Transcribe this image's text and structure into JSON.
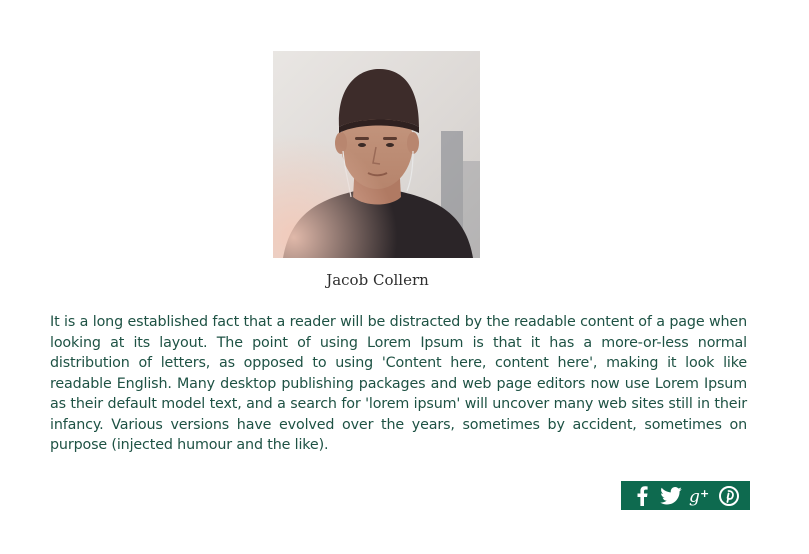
{
  "profile": {
    "name": "Jacob Collern",
    "bio": "It is a long established fact that a reader will be distracted by the readable content of a page when looking at its layout. The point of using Lorem Ipsum is that it has a more-or-less normal distribution of letters, as opposed to using 'Content here, content here', making it look like readable English. Many desktop publishing packages and web page editors now use Lorem Ipsum as their default model text, and a search for 'lorem ipsum' will uncover many web sites still in their infancy. Various versions have evolved over the years, sometimes by accident, sometimes on purpose (injected humour and the like)."
  },
  "share": {
    "background": "#0e6a4f",
    "icon_color": "#ffffff",
    "buttons": [
      {
        "icon": "facebook-icon"
      },
      {
        "icon": "twitter-icon"
      },
      {
        "icon": "google-plus-icon"
      },
      {
        "icon": "pinterest-icon"
      }
    ]
  },
  "colors": {
    "bio_text": "#1e5244",
    "caption_text": "#2f2f2f"
  }
}
